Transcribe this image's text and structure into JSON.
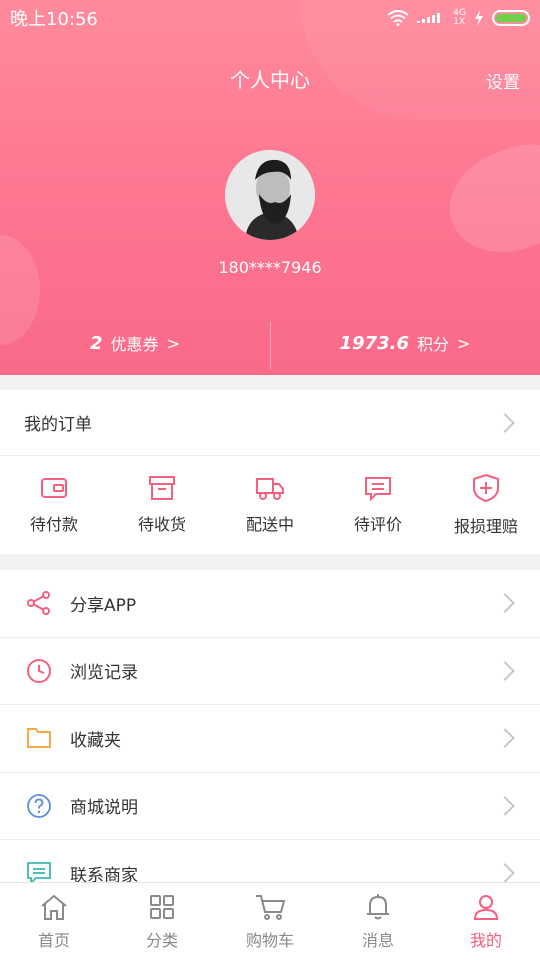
{
  "status_bar": {
    "time": "晚上10:56",
    "net_top": "4G",
    "net_bottom": "1X"
  },
  "header": {
    "title": "个人中心",
    "settings_label": "设置",
    "phone": "180****7946"
  },
  "stats": {
    "coupons": {
      "value": "2",
      "label": "优惠券",
      "arrow": ">"
    },
    "points": {
      "value": "1973.6",
      "label": "积分",
      "arrow": ">"
    }
  },
  "orders": {
    "title": "我的订单",
    "items": [
      {
        "label": "待付款",
        "icon": "wallet-icon"
      },
      {
        "label": "待收货",
        "icon": "box-icon"
      },
      {
        "label": "配送中",
        "icon": "truck-icon"
      },
      {
        "label": "待评价",
        "icon": "comment-icon"
      },
      {
        "label": "报损理赔",
        "icon": "shield-plus-icon"
      }
    ]
  },
  "menu": [
    {
      "label": "分享APP",
      "icon": "share-icon"
    },
    {
      "label": "浏览记录",
      "icon": "clock-icon"
    },
    {
      "label": "收藏夹",
      "icon": "folder-icon"
    },
    {
      "label": "商城说明",
      "icon": "help-icon"
    },
    {
      "label": "联系商家",
      "icon": "message-icon"
    }
  ],
  "tabs": [
    {
      "label": "首页",
      "icon": "home-icon"
    },
    {
      "label": "分类",
      "icon": "grid-icon"
    },
    {
      "label": "购物车",
      "icon": "cart-icon"
    },
    {
      "label": "消息",
      "icon": "bell-icon"
    },
    {
      "label": "我的",
      "icon": "user-icon",
      "active": true
    }
  ],
  "colors": {
    "accent": "#f5607f",
    "header_top": "#ff8a9c",
    "header_bottom": "#f96a88"
  }
}
